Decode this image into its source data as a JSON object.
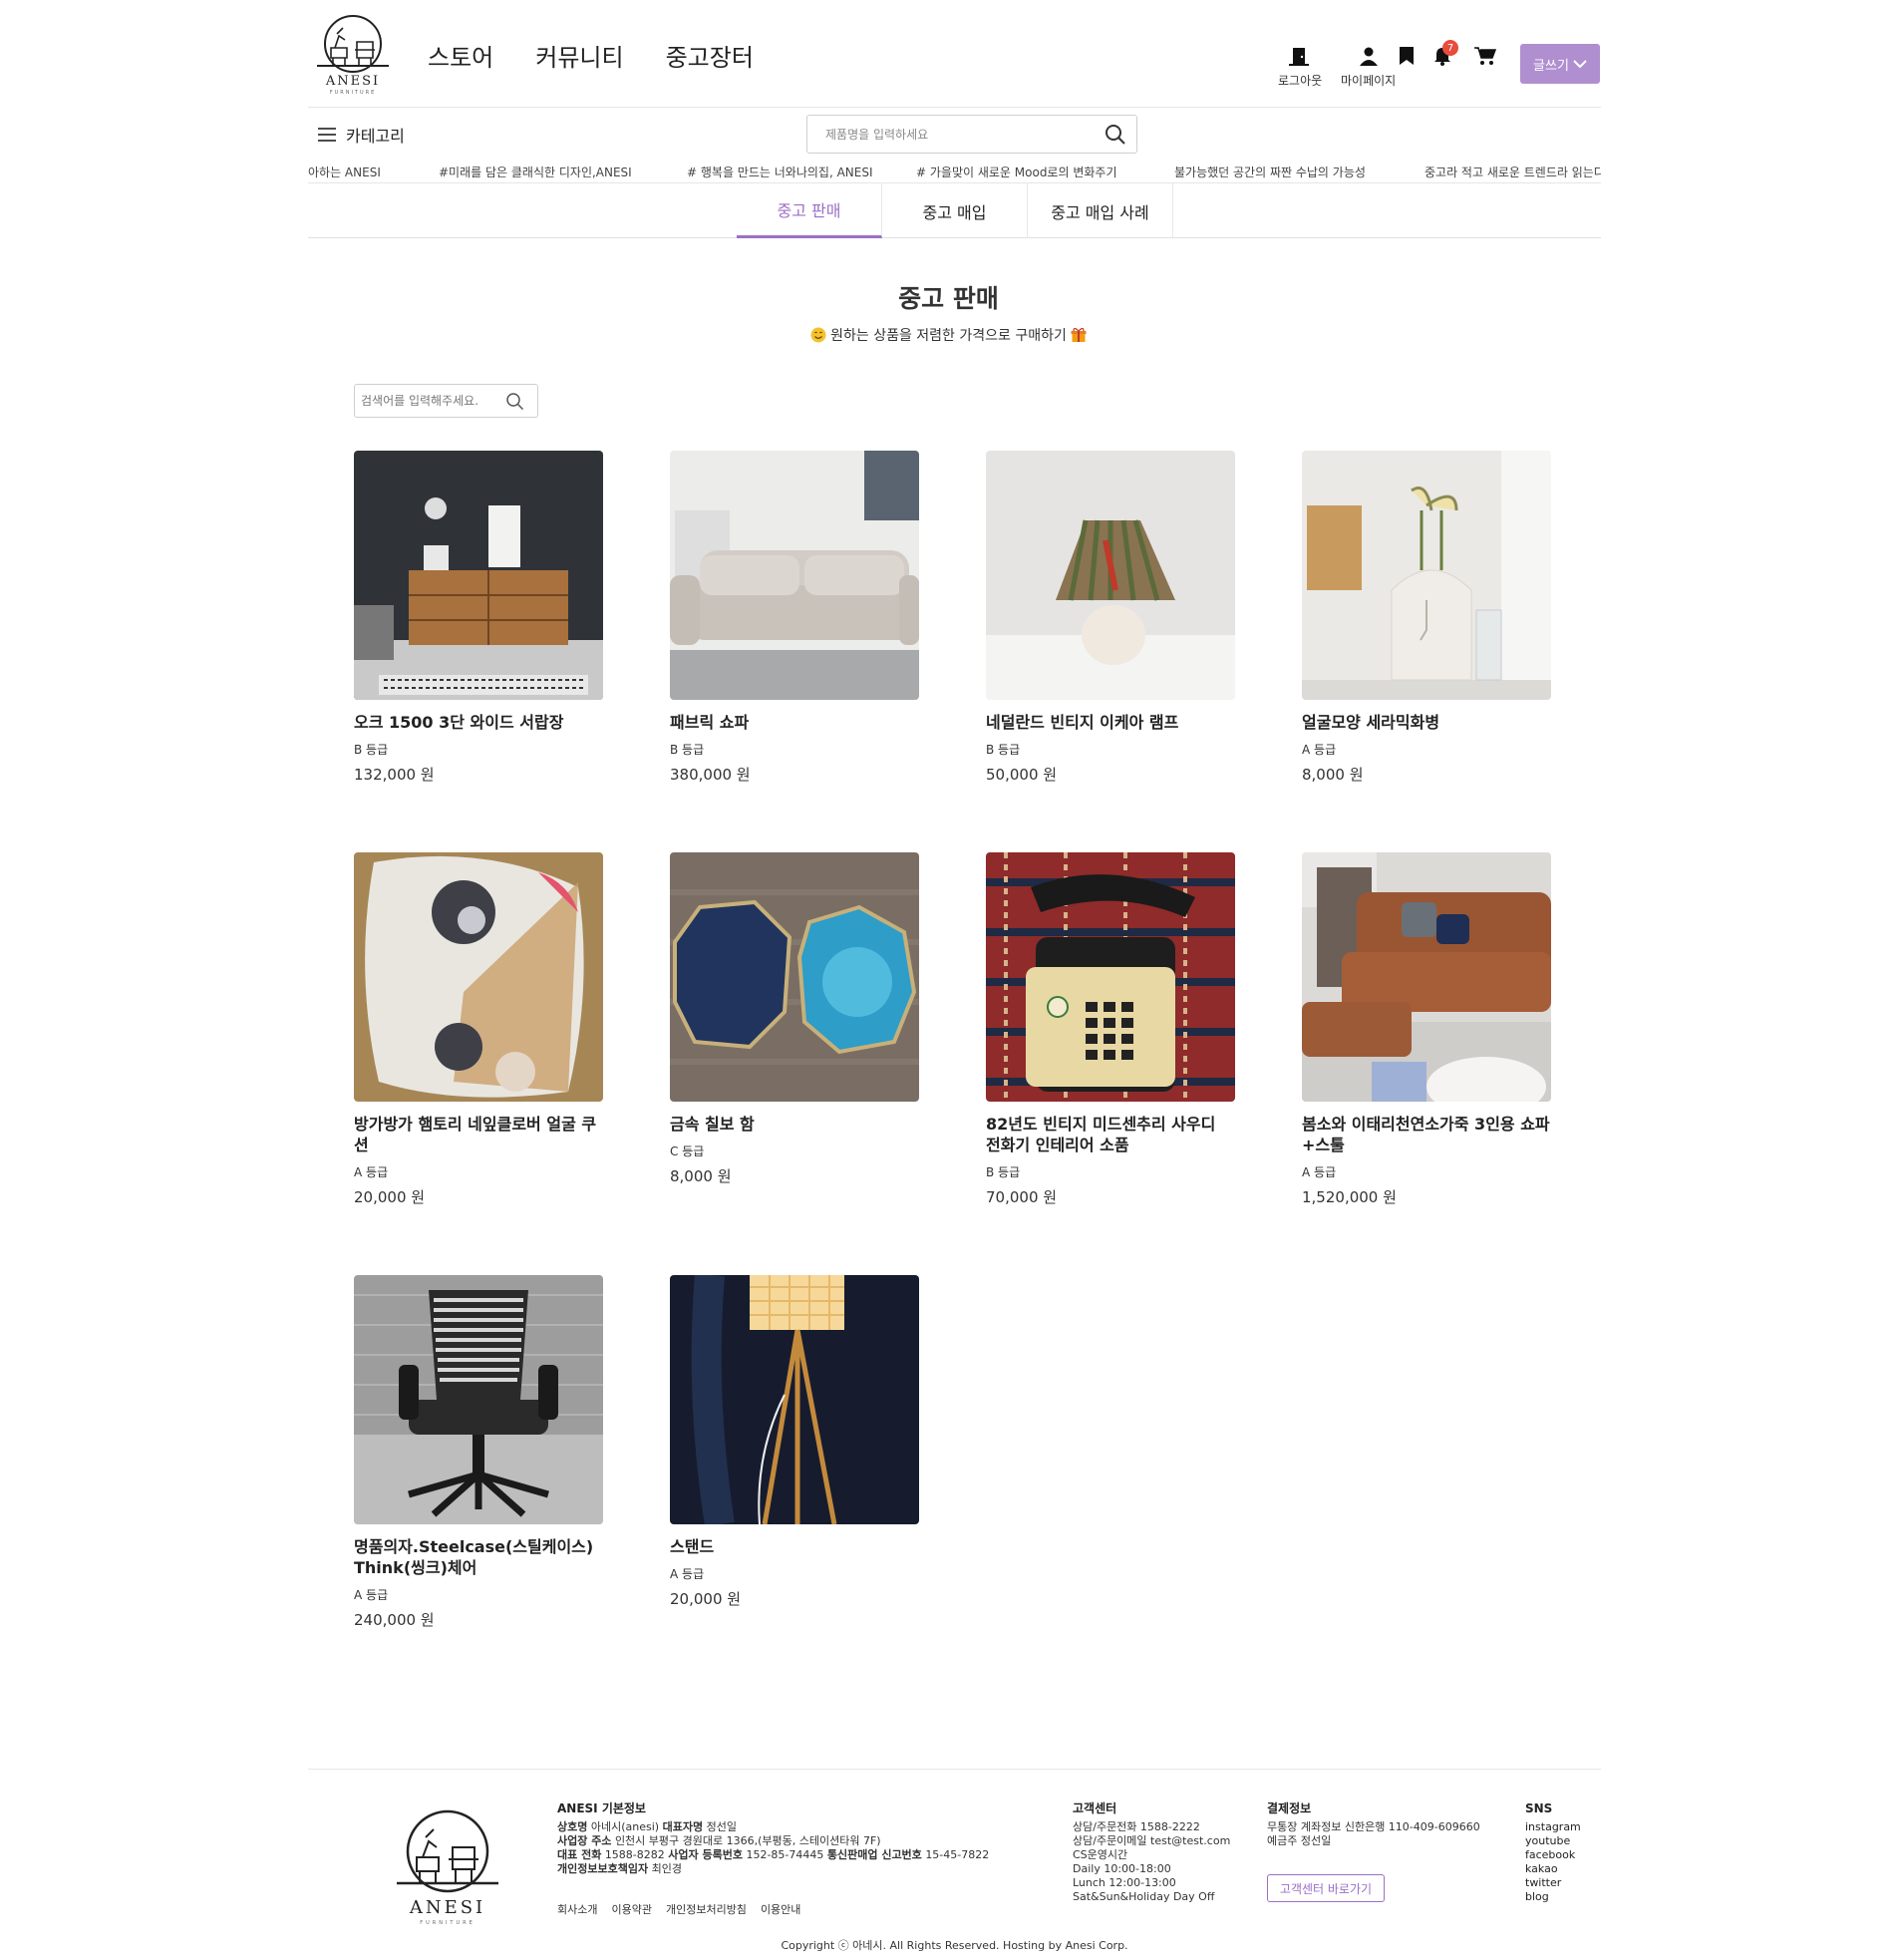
{
  "header": {
    "brand": "ANESI",
    "brand_sub": "FURNITURE",
    "nav": [
      "스토어",
      "커뮤니티",
      "중고장터"
    ],
    "logout_label": "로그아웃",
    "mypage_label": "마이페이지",
    "notification_count": "7",
    "write_label": "글쓰기"
  },
  "category": {
    "toggle_label": "카테고리",
    "search_placeholder": "제품명을 입력하세요"
  },
  "ticker": [
    "아하는 ANESI",
    "#미래를 담은 클래식한 디자인,ANESI",
    "# 행복을 만드는 너와나의집, ANESI",
    "# 가을맞이 새로운 Mood로의 변화주기",
    "불가능했던 공간의 짜짠 수납의 가능성",
    "중고라 적고 새로운 트렌드라 읽는다"
  ],
  "tabs": [
    "중고 판매",
    "중고 매입",
    "중고 매입 사례"
  ],
  "page": {
    "title": "중고 판매",
    "subtitle": "원하는 상품을 저렴한 가격으로 구매하기",
    "search_placeholder": "검색어를 입력해주세요."
  },
  "products": [
    {
      "name": "오크 1500 3단 와이드 서랍장",
      "grade": "B 등급",
      "price": "132,000 원"
    },
    {
      "name": "패브릭 쇼파",
      "grade": "B 등급",
      "price": "380,000 원"
    },
    {
      "name": "네덜란드 빈티지 이케아 램프",
      "grade": "B 등급",
      "price": "50,000 원"
    },
    {
      "name": "얼굴모양 세라믹화병",
      "grade": "A 등급",
      "price": "8,000 원"
    },
    {
      "name": "방가방가 햄토리 네잎클로버 얼굴 쿠션",
      "grade": "A 등급",
      "price": "20,000 원"
    },
    {
      "name": "금속 칠보 함",
      "grade": "C 등급",
      "price": "8,000 원"
    },
    {
      "name": "82년도 빈티지 미드센추리 사우디 전화기 인테리어 소품",
      "grade": "B 등급",
      "price": "70,000 원"
    },
    {
      "name": "봄소와 이태리천연소가죽 3인용 쇼파+스툴",
      "grade": "A 등급",
      "price": "1,520,000 원"
    },
    {
      "name": "명품의자.Steelcase(스틸케이스) Think(씽크)체어",
      "grade": "A 등급",
      "price": "240,000 원"
    },
    {
      "name": "스탠드",
      "grade": "A 등급",
      "price": "20,000 원"
    }
  ],
  "footer": {
    "info_title": "ANESI 기본정보",
    "info_lines": [
      {
        "k": "상호명",
        "v": "아네시(anesi)",
        "k2": "대표자명",
        "v2": "정선일"
      },
      {
        "k": "사업장 주소",
        "v": "인천시 부평구 경원대로 1366,(부평동, 스테이션타워 7F)",
        "k2": "",
        "v2": ""
      },
      {
        "k": "대표 전화",
        "v": "1588-8282",
        "k2": "사업자 등록번호",
        "v2": "152-85-74445"
      },
      {
        "k": "개인정보보호책임자",
        "v": "최인경",
        "k2": "",
        "v2": ""
      }
    ],
    "info_line3_extra_k": "통신판매업 신고번호",
    "info_line3_extra_v": "15-45-7822",
    "links": [
      "회사소개",
      "이용약관",
      "개인정보처리방침",
      "이용안내"
    ],
    "cs_title": "고객센터",
    "cs_lines": [
      "상담/주문전화 1588-2222",
      "상담/주문이메일 test@test.com",
      "CS운영시간",
      "Daily 10:00-18:00",
      "Lunch 12:00-13:00",
      "Sat&Sun&Holiday Day Off"
    ],
    "pay_title": "결제정보",
    "pay_lines": [
      "무통장 계좌정보 신한은행 110-409-609660",
      "예금주 정선일"
    ],
    "cs_button": "고객센터 바로가기",
    "sns_title": "SNS",
    "sns": [
      "instagram",
      "youtube",
      "facebook",
      "kakao",
      "twitter",
      "blog"
    ],
    "copyright": "Copyright ⓒ 아네시. All Rights Reserved. Hosting by Anesi Corp."
  },
  "colors": {
    "accent": "#9b6fc7",
    "write_button": "#b08fd0",
    "badge": "#e74c3c"
  }
}
